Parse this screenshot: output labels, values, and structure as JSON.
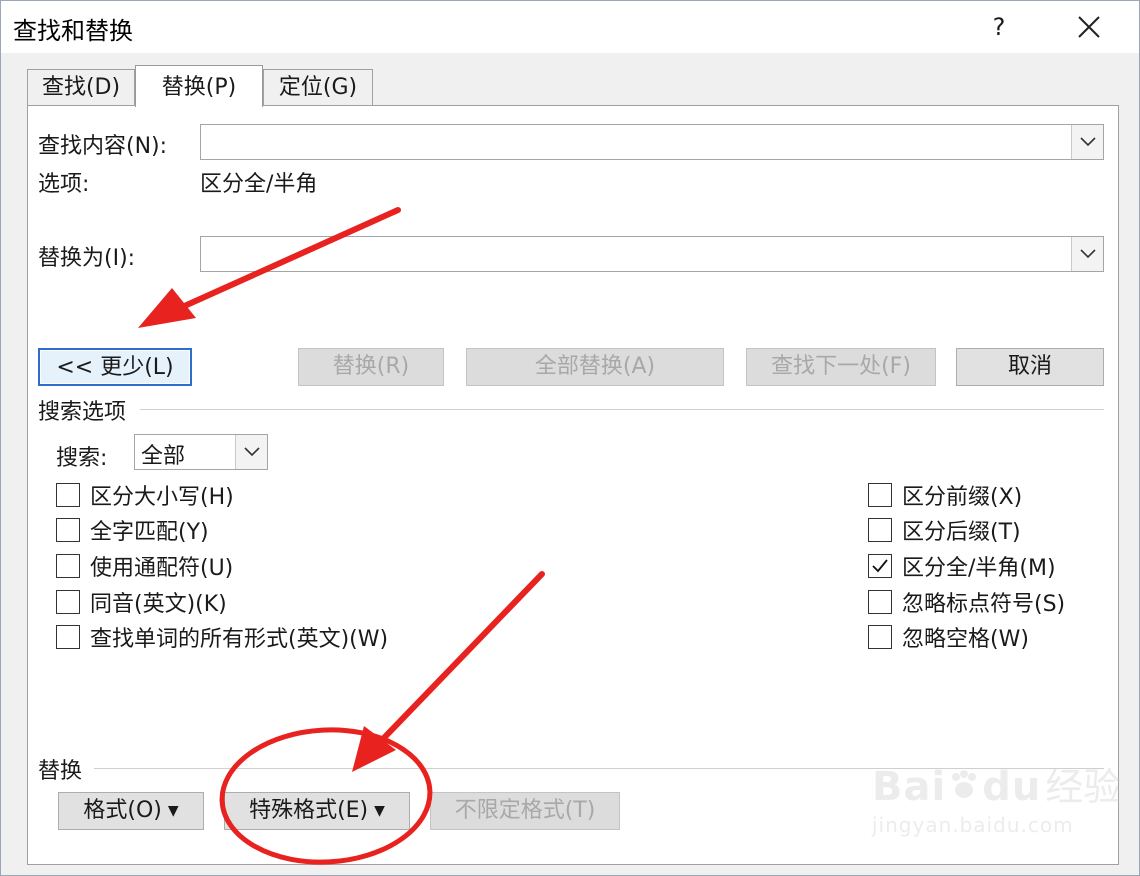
{
  "window": {
    "title": "查找和替换",
    "help_label": "?"
  },
  "tabs": [
    {
      "label": "查找(D)"
    },
    {
      "label": "替换(P)"
    },
    {
      "label": "定位(G)"
    }
  ],
  "find": {
    "label": "查找内容(N):",
    "value": ""
  },
  "options": {
    "label": "选项:",
    "value": "区分全/半角"
  },
  "replace": {
    "label": "替换为(I):",
    "value": ""
  },
  "buttons": {
    "less": "<< 更少(L)",
    "replace": "替换(R)",
    "replace_all": "全部替换(A)",
    "find_next": "查找下一处(F)",
    "cancel": "取消"
  },
  "search_options": {
    "heading": "搜索选项",
    "search_label": "搜索:",
    "search_value": "全部",
    "left": [
      {
        "label": "区分大小写(H)",
        "checked": false
      },
      {
        "label": "全字匹配(Y)",
        "checked": false
      },
      {
        "label": "使用通配符(U)",
        "checked": false
      },
      {
        "label": "同音(英文)(K)",
        "checked": false
      },
      {
        "label": "查找单词的所有形式(英文)(W)",
        "checked": false
      }
    ],
    "right": [
      {
        "label": "区分前缀(X)",
        "checked": false
      },
      {
        "label": "区分后缀(T)",
        "checked": false
      },
      {
        "label": "区分全/半角(M)",
        "checked": true
      },
      {
        "label": "忽略标点符号(S)",
        "checked": false
      },
      {
        "label": "忽略空格(W)",
        "checked": false
      }
    ]
  },
  "replace_section": {
    "heading": "替换",
    "format": "格式(O)",
    "special": "特殊格式(E)",
    "no_format": "不限定格式(T)"
  },
  "watermark": {
    "brand": "Bai",
    "brand2": "du",
    "cn": "经验",
    "sub": "jingyan.baidu.com"
  },
  "annotation_color": "#e8231f"
}
